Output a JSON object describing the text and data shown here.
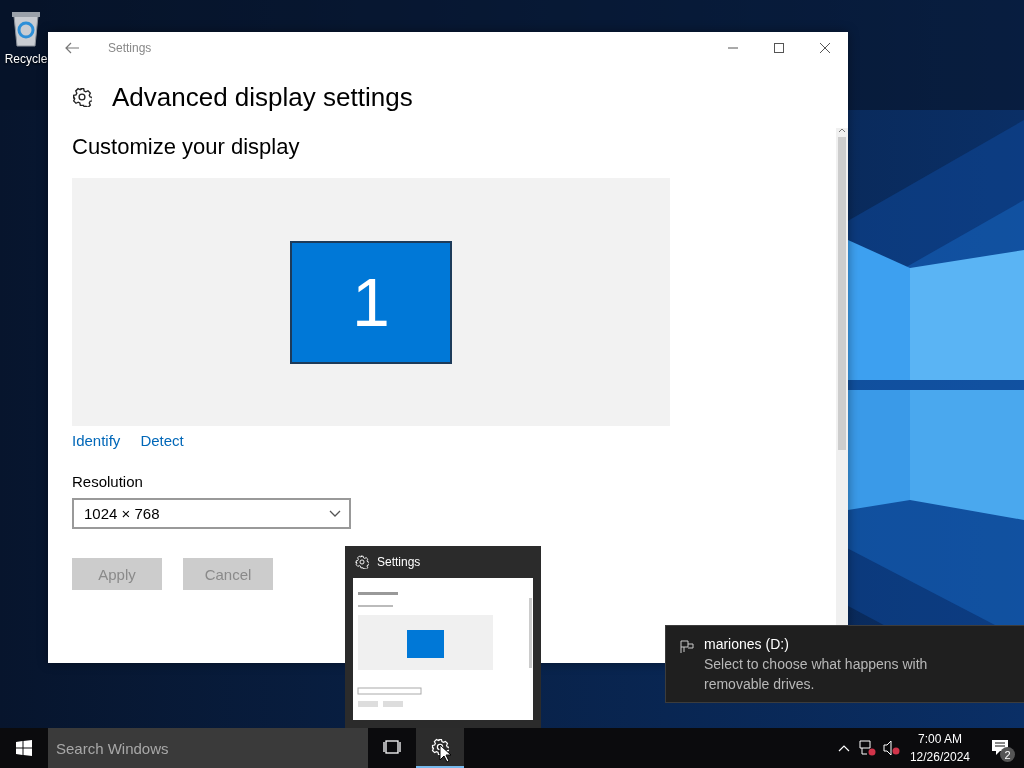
{
  "desktop": {
    "icons": [
      {
        "label": "Recycle"
      }
    ]
  },
  "window": {
    "title": "Settings",
    "heading": "Advanced display settings",
    "section": "Customize your display",
    "display_number": "1",
    "links": [
      "Identify",
      "Detect"
    ],
    "resolution": {
      "label": "Resolution",
      "value": "1024 × 768"
    },
    "buttons": [
      {
        "label": "Apply",
        "disabled": true
      },
      {
        "label": "Cancel",
        "disabled": true
      }
    ]
  },
  "thumbnail_popup": {
    "title": "Settings"
  },
  "notification": {
    "title": "mariones (D:)",
    "body": "Select to choose what happens with removable drives."
  },
  "taskbar": {
    "search": {
      "placeholder": "Search Windows"
    },
    "apps": [
      {
        "kind": "task-view",
        "active": false
      },
      {
        "kind": "settings",
        "active": true
      }
    ],
    "clock": {
      "time": "7:00 AM",
      "date": "12/26/2024"
    },
    "notification_count": "2"
  }
}
